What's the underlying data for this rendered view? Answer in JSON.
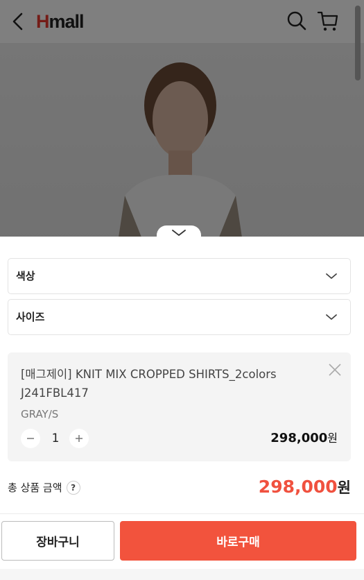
{
  "header": {
    "logo_first": "H",
    "logo_rest": "mall"
  },
  "options": {
    "color_label": "색상",
    "size_label": "사이즈"
  },
  "item": {
    "name": "[매그제이] KNIT MIX CROPPED SHIRTS_2colors J241FBL417",
    "option": "GRAY/S",
    "quantity": "1",
    "price": "298,000",
    "price_unit": "원"
  },
  "total": {
    "label": "총 상품 금액",
    "help": "?",
    "price": "298,000",
    "unit": "원"
  },
  "actions": {
    "cart_label": "장바구니",
    "buy_label": "바로구매"
  },
  "colors": {
    "brand_red": "#e8382e",
    "buy_button": "#f2533d",
    "total_price": "#f0513f"
  }
}
